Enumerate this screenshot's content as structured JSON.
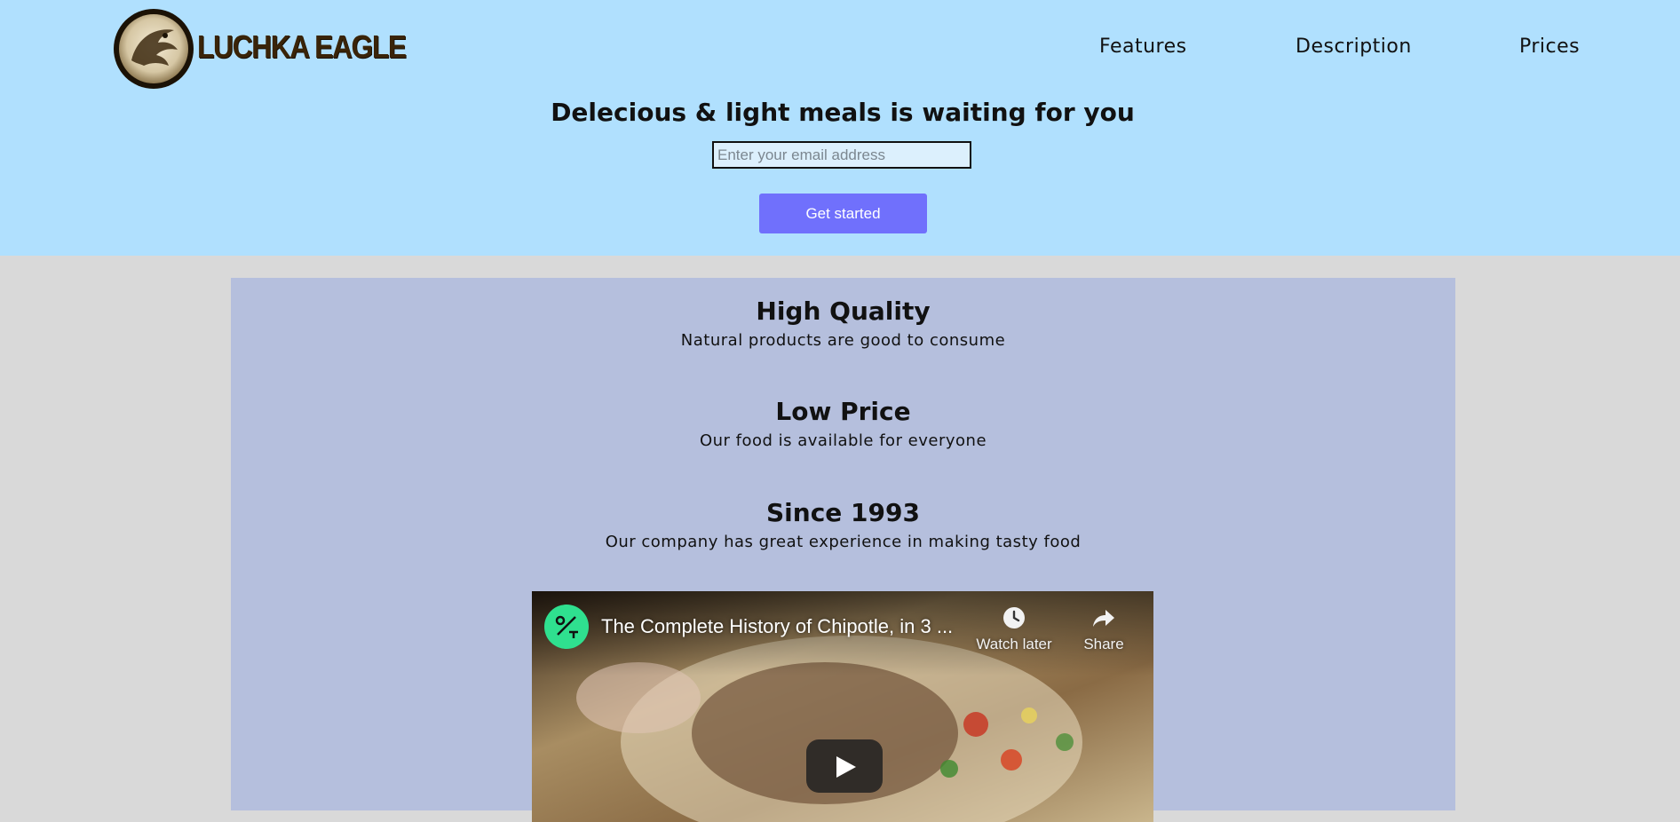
{
  "header": {
    "logo_text": "LUCHKA EAGLE",
    "nav": [
      {
        "label": "Features"
      },
      {
        "label": "Description"
      },
      {
        "label": "Prices"
      }
    ],
    "hero_title": "Delecious & light meals is waiting for you",
    "email_placeholder": "Enter your email address",
    "cta_label": "Get started"
  },
  "features": [
    {
      "title": "High Quality",
      "text": "Natural products are good to consume"
    },
    {
      "title": "Low Price",
      "text": "Our food is available for everyone"
    },
    {
      "title": "Since 1993",
      "text": "Our company has great experience in making tasty food"
    }
  ],
  "video": {
    "title": "The Complete History of Chipotle, in 3 ...",
    "watch_later_label": "Watch later",
    "share_label": "Share",
    "channel_icon": "percent-glyph-icon",
    "play_icon": "play-icon"
  },
  "colors": {
    "header_bg": "#b0e0fe",
    "page_bg": "#d9d9d9",
    "features_bg": "#b5bfdd",
    "cta_bg": "#7070fc",
    "channel_icon_bg": "#2fe08f"
  }
}
